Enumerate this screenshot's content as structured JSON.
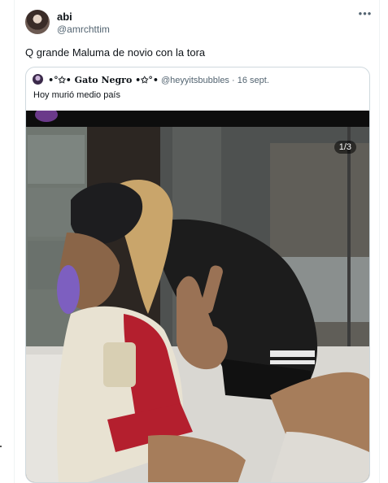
{
  "tweet": {
    "author_name": "abi",
    "author_handle": "@amrchttim",
    "more_icon": "more-dots-icon",
    "text": "Q grande Maluma de novio con la tora"
  },
  "quote": {
    "author_name": "•°✩• Gato Negro •✩°•",
    "author_handle": "@heyyitsbubbles",
    "separator": "·",
    "date": "16 sept.",
    "text": "Hoy murió medio país",
    "media_counter": "1/3"
  }
}
